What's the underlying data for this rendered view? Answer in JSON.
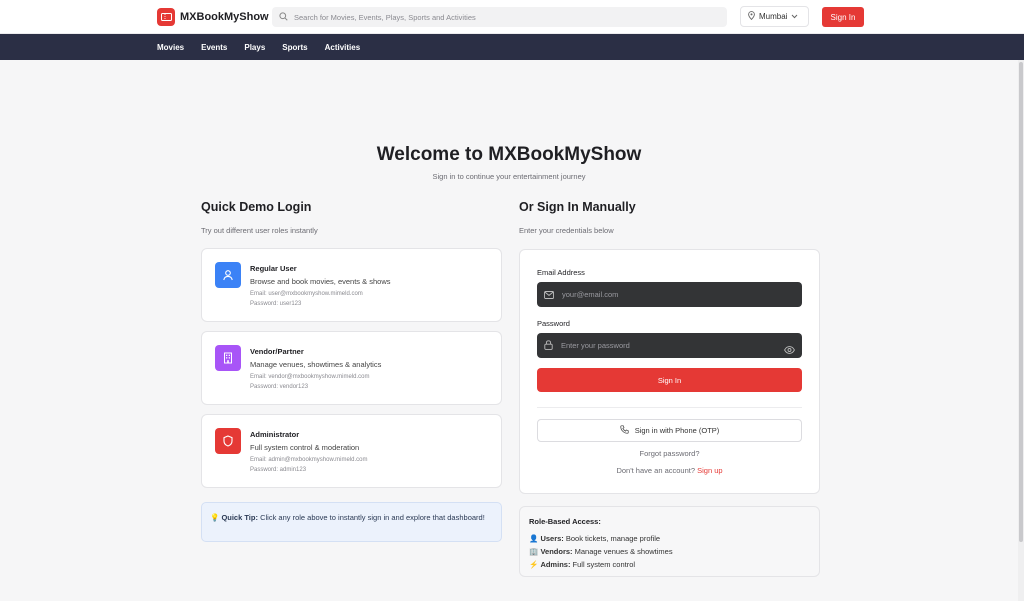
{
  "header": {
    "brand": "MXBookMyShow",
    "search_placeholder": "Search for Movies, Events, Plays, Sports and Activities",
    "city": "Mumbai",
    "signin_label": "Sign In"
  },
  "nav": {
    "items": [
      "Movies",
      "Events",
      "Plays",
      "Sports",
      "Activities"
    ]
  },
  "hero": {
    "title": "Welcome to MXBookMyShow",
    "subtitle": "Sign in to continue your entertainment journey"
  },
  "demo": {
    "title": "Quick Demo Login",
    "subtitle": "Try out different user roles instantly",
    "cards": [
      {
        "title": "Regular User",
        "desc": "Browse and book movies, events & shows",
        "email": "Email: user@mxbookmyshow.mimeld.com",
        "password": "Password: user123",
        "icon": "user-icon",
        "color": "#3b82f6"
      },
      {
        "title": "Vendor/Partner",
        "desc": "Manage venues, showtimes & analytics",
        "email": "Email: vendor@mxbookmyshow.mimeld.com",
        "password": "Password: vendor123",
        "icon": "building-icon",
        "color": "#a855f7"
      },
      {
        "title": "Administrator",
        "desc": "Full system control & moderation",
        "email": "Email: admin@mxbookmyshow.mimeld.com",
        "password": "Password: admin123",
        "icon": "shield-icon",
        "color": "#e53935"
      }
    ],
    "tip": {
      "emoji": "💡",
      "label": "Quick Tip:",
      "text": " Click any role above to instantly sign in and explore that dashboard!"
    }
  },
  "manual": {
    "title": "Or Sign In Manually",
    "subtitle": "Enter your credentials below",
    "email_label": "Email Address",
    "email_placeholder": "your@email.com",
    "password_label": "Password",
    "password_placeholder": "Enter your password",
    "submit_label": "Sign In",
    "otp_label": "Sign in with Phone (OTP)",
    "forgot_label": "Forgot password?",
    "no_account_text": "Don't have an account?",
    "signup_label": "Sign up"
  },
  "roles": {
    "title": "Role-Based Access:",
    "items": [
      {
        "emoji": "👤",
        "label": "Users:",
        "text": " Book tickets, manage profile"
      },
      {
        "emoji": "🏢",
        "label": "Vendors:",
        "text": " Manage venues & showtimes"
      },
      {
        "emoji": "⚡",
        "label": "Admins:",
        "text": " Full system control"
      }
    ]
  },
  "colors": {
    "accent": "#e53935",
    "nav_bg": "#2b2f45",
    "input_bg": "#333436"
  }
}
